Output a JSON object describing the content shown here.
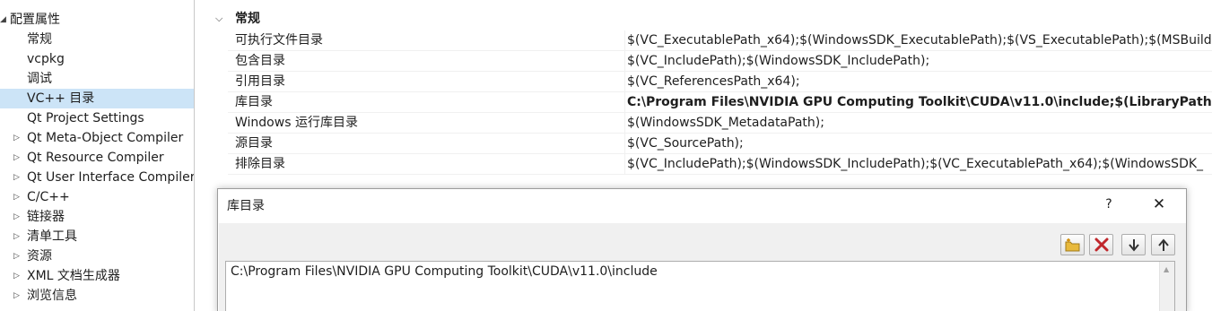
{
  "tree": {
    "items": [
      {
        "label": "配置属性",
        "arrow": "◢"
      },
      {
        "label": "常规",
        "arrow": ""
      },
      {
        "label": "vcpkg",
        "arrow": ""
      },
      {
        "label": "调试",
        "arrow": ""
      },
      {
        "label": "VC++ 目录",
        "arrow": ""
      },
      {
        "label": "Qt Project Settings",
        "arrow": ""
      },
      {
        "label": "Qt Meta-Object Compiler",
        "arrow": "▷"
      },
      {
        "label": "Qt Resource Compiler",
        "arrow": "▷"
      },
      {
        "label": "Qt User Interface Compiler",
        "arrow": "▷"
      },
      {
        "label": "C/C++",
        "arrow": "▷"
      },
      {
        "label": "链接器",
        "arrow": "▷"
      },
      {
        "label": "清单工具",
        "arrow": "▷"
      },
      {
        "label": "资源",
        "arrow": "▷"
      },
      {
        "label": "XML 文档生成器",
        "arrow": "▷"
      },
      {
        "label": "浏览信息",
        "arrow": "▷"
      }
    ],
    "selected_index": 4
  },
  "grid": {
    "section_chevron": "⌵",
    "section_title": "常规",
    "rows": [
      {
        "name": "可执行文件目录",
        "value": "$(VC_ExecutablePath_x64);$(WindowsSDK_ExecutablePath);$(VS_ExecutablePath);$(MSBuild"
      },
      {
        "name": "包含目录",
        "value": "$(VC_IncludePath);$(WindowsSDK_IncludePath);"
      },
      {
        "name": "引用目录",
        "value": "$(VC_ReferencesPath_x64);"
      },
      {
        "name": "库目录",
        "value": "C:\\Program Files\\NVIDIA GPU Computing Toolkit\\CUDA\\v11.0\\include;$(LibraryPath)",
        "bold": true
      },
      {
        "name": "Windows 运行库目录",
        "value": "$(WindowsSDK_MetadataPath);"
      },
      {
        "name": "源目录",
        "value": "$(VC_SourcePath);"
      },
      {
        "name": "排除目录",
        "value": "$(VC_IncludePath);$(WindowsSDK_IncludePath);$(VC_ExecutablePath_x64);$(WindowsSDK_"
      }
    ]
  },
  "dialog": {
    "title": "库目录",
    "help_label": "?",
    "close_label": "✕",
    "toolbar": {
      "new_line_icon": "new-line-folder-icon",
      "delete_icon": "delete-x-icon",
      "move_down_icon": "arrow-down-icon",
      "move_up_icon": "arrow-up-icon"
    },
    "list": {
      "lines": [
        "C:\\Program Files\\NVIDIA GPU Computing Toolkit\\CUDA\\v11.0\\include"
      ]
    }
  },
  "colors": {
    "selection": "#cce4f7",
    "delete_red": "#c0262b",
    "folder_yellow": "#e8b93c"
  }
}
